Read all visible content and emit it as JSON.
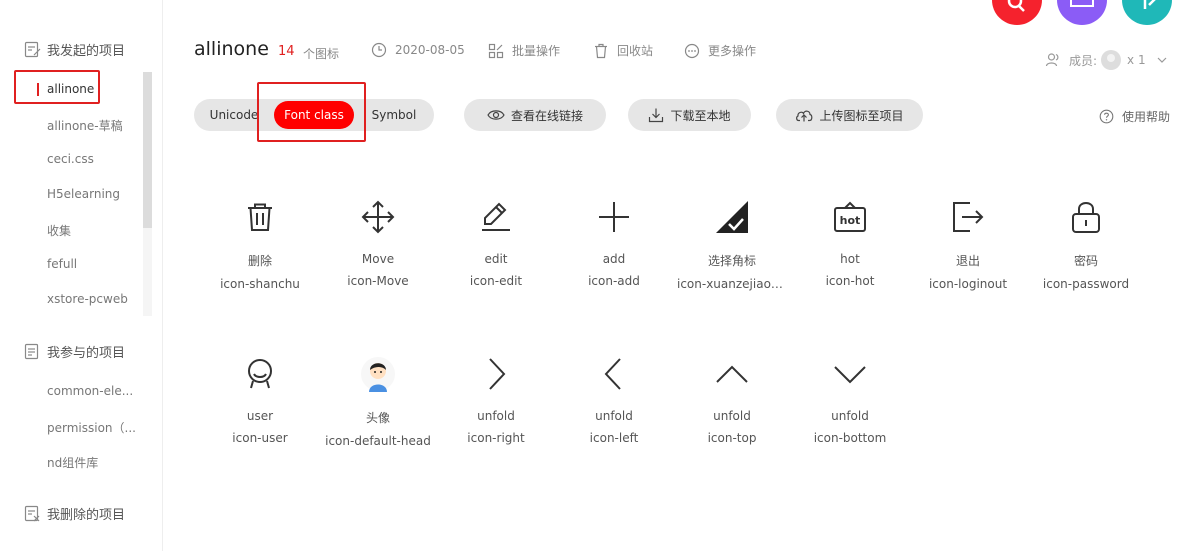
{
  "sidebar": {
    "my_projects_title": "我发起的项目",
    "my_projects": [
      "allinone",
      "allinone-草稿",
      "ceci.css",
      "H5elearning",
      "收集",
      "fefull",
      "xstore-pcweb"
    ],
    "joined_title": "我参与的项目",
    "joined": [
      "common-ele...",
      "permission（...",
      "nd组件库"
    ],
    "deleted_title": "我删除的项目"
  },
  "header": {
    "project_name": "allinone",
    "icon_count": "14",
    "icon_count_label": "个图标",
    "date": "2020-08-05",
    "batch_label": "批量操作",
    "recycle_label": "回收站",
    "more_label": "更多操作",
    "members_label": "成员:",
    "members_count": "x 1"
  },
  "toolbar": {
    "unicode": "Unicode",
    "font_class": "Font class",
    "symbol": "Symbol",
    "view_link": "查看在线链接",
    "download": "下载至本地",
    "upload": "上传图标至项目",
    "help": "使用帮助"
  },
  "icons": [
    {
      "name": "删除",
      "cls": "icon-shanchu",
      "glyph": "trash-icon"
    },
    {
      "name": "Move",
      "cls": "icon-Move",
      "glyph": "move-icon"
    },
    {
      "name": "edit",
      "cls": "icon-edit",
      "glyph": "edit-icon"
    },
    {
      "name": "add",
      "cls": "icon-add",
      "glyph": "plus-icon"
    },
    {
      "name": "选择角标",
      "cls": "icon-xuanzejiaob...",
      "glyph": "corner-check-icon"
    },
    {
      "name": "hot",
      "cls": "icon-hot",
      "glyph": "hot-icon"
    },
    {
      "name": "退出",
      "cls": "icon-loginout",
      "glyph": "logout-icon"
    },
    {
      "name": "密码",
      "cls": "icon-password",
      "glyph": "lock-icon"
    },
    {
      "name": "user",
      "cls": "icon-user",
      "glyph": "user-icon"
    },
    {
      "name": "头像",
      "cls": "icon-default-head",
      "glyph": "default-avatar-icon"
    },
    {
      "name": "unfold",
      "cls": "icon-right",
      "glyph": "chevron-right-icon"
    },
    {
      "name": "unfold",
      "cls": "icon-left",
      "glyph": "chevron-left-icon"
    },
    {
      "name": "unfold",
      "cls": "icon-top",
      "glyph": "chevron-up-icon"
    },
    {
      "name": "unfold",
      "cls": "icon-bottom",
      "glyph": "chevron-down-icon"
    }
  ],
  "colors": {
    "accent": "#ff0000",
    "highlight_box": "#e02020",
    "fab_red": "#f5222d",
    "fab_purple": "#8b5cf6",
    "fab_teal": "#1fb8b8"
  }
}
